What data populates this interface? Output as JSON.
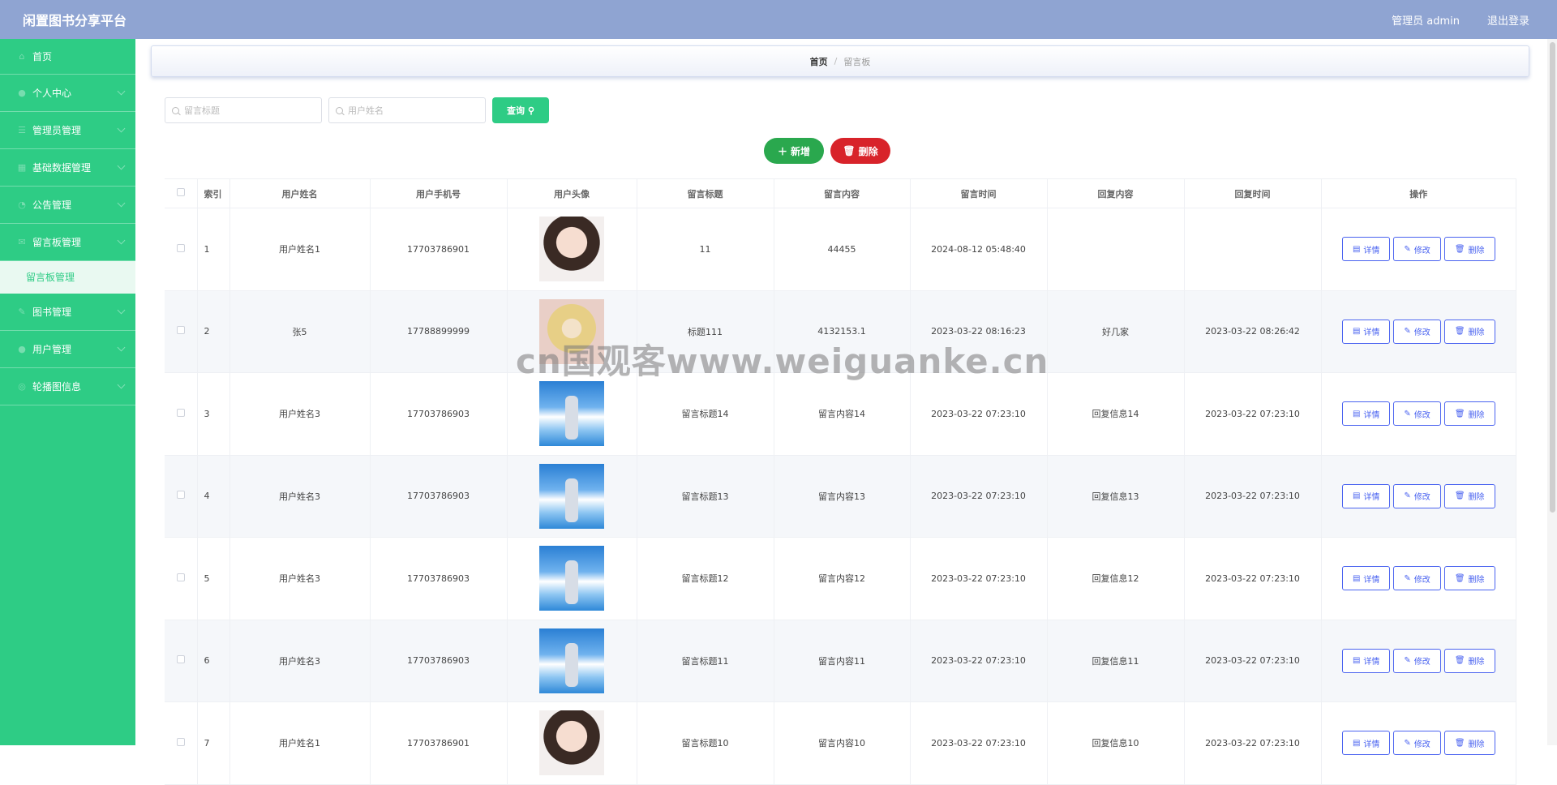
{
  "header": {
    "title": "闲置图书分享平台",
    "admin_label": "管理员 admin",
    "logout_label": "退出登录"
  },
  "sidebar": {
    "items": [
      {
        "label": "首页"
      },
      {
        "label": "个人中心"
      },
      {
        "label": "管理员管理"
      },
      {
        "label": "基础数据管理"
      },
      {
        "label": "公告管理"
      },
      {
        "label": "留言板管理"
      },
      {
        "label": "图书管理"
      },
      {
        "label": "用户管理"
      },
      {
        "label": "轮播图信息"
      }
    ],
    "active_sub": "留言板管理"
  },
  "breadcrumb": {
    "home": "首页",
    "separator": "/",
    "current": "留言板"
  },
  "search": {
    "title_placeholder": "留言标题",
    "name_placeholder": "用户姓名",
    "query_label": "查询"
  },
  "actions": {
    "add_label": "新增",
    "delete_label": "删除"
  },
  "table": {
    "headers": [
      "索引",
      "用户姓名",
      "用户手机号",
      "用户头像",
      "留言标题",
      "留言内容",
      "留言时间",
      "回复内容",
      "回复时间",
      "操作"
    ],
    "rows": [
      {
        "index": "1",
        "name": "用户姓名1",
        "phone": "17703786901",
        "avatar": "portrait-woman",
        "title": "11",
        "content": "44455",
        "time": "2024-08-12 05:48:40",
        "reply": "",
        "reply_time": ""
      },
      {
        "index": "2",
        "name": "张5",
        "phone": "17788899999",
        "avatar": "anime-girl",
        "title": "标题111",
        "content": "4132153.1",
        "time": "2023-03-22 08:16:23",
        "reply": "好几家",
        "reply_time": "2023-03-22 08:26:42"
      },
      {
        "index": "3",
        "name": "用户姓名3",
        "phone": "17703786903",
        "avatar": "man-sky",
        "title": "留言标题14",
        "content": "留言内容14",
        "time": "2023-03-22 07:23:10",
        "reply": "回复信息14",
        "reply_time": "2023-03-22 07:23:10"
      },
      {
        "index": "4",
        "name": "用户姓名3",
        "phone": "17703786903",
        "avatar": "man-sky",
        "title": "留言标题13",
        "content": "留言内容13",
        "time": "2023-03-22 07:23:10",
        "reply": "回复信息13",
        "reply_time": "2023-03-22 07:23:10"
      },
      {
        "index": "5",
        "name": "用户姓名3",
        "phone": "17703786903",
        "avatar": "man-sky",
        "title": "留言标题12",
        "content": "留言内容12",
        "time": "2023-03-22 07:23:10",
        "reply": "回复信息12",
        "reply_time": "2023-03-22 07:23:10"
      },
      {
        "index": "6",
        "name": "用户姓名3",
        "phone": "17703786903",
        "avatar": "man-sky",
        "title": "留言标题11",
        "content": "留言内容11",
        "time": "2023-03-22 07:23:10",
        "reply": "回复信息11",
        "reply_time": "2023-03-22 07:23:10"
      },
      {
        "index": "7",
        "name": "用户姓名1",
        "phone": "17703786901",
        "avatar": "portrait-woman",
        "title": "留言标题10",
        "content": "留言内容10",
        "time": "2023-03-22 07:23:10",
        "reply": "回复信息10",
        "reply_time": "2023-03-22 07:23:10"
      }
    ],
    "row_actions": {
      "detail": "详情",
      "edit": "修改",
      "delete": "删除"
    }
  },
  "watermark": "cn国观客www.weiguanke.cn",
  "colors": {
    "header": "#8fa4d2",
    "sidebar": "#2ecc85",
    "add": "#2aa84e",
    "danger": "#d8232a",
    "link": "#4a63f0"
  }
}
